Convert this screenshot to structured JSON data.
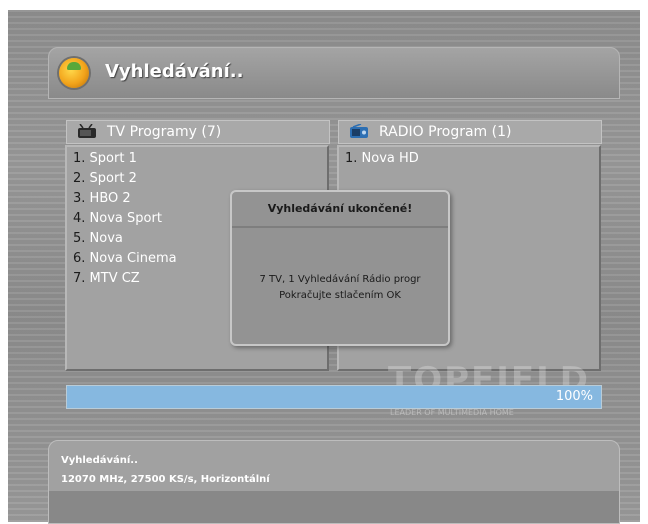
{
  "title": "Vyhledávání..",
  "tv_panel": {
    "title": "TV Programy (7)",
    "channels": [
      {
        "num": "1.",
        "name": "Sport 1"
      },
      {
        "num": "2.",
        "name": "Sport 2"
      },
      {
        "num": "3.",
        "name": "HBO 2"
      },
      {
        "num": "4.",
        "name": "Nova Sport"
      },
      {
        "num": "5.",
        "name": "Nova"
      },
      {
        "num": "6.",
        "name": "Nova Cinema"
      },
      {
        "num": "7.",
        "name": "MTV CZ"
      }
    ]
  },
  "radio_panel": {
    "title": "RADIO Program (1)",
    "channels": [
      {
        "num": "1.",
        "name": "Nova HD"
      }
    ]
  },
  "dialog": {
    "title": "Vyhledávání ukončené!",
    "line1": "7 TV, 1 Vyhledávání Rádio progr",
    "line2": "Pokračujte stlačením OK"
  },
  "progress": {
    "percent_label": "100%",
    "value": 100
  },
  "watermark": {
    "brand": "TOPFIELD",
    "tagline": "LEADER OF MULTIMEDIA HOME"
  },
  "info": {
    "status": "Vyhledávání..",
    "transponder": "12070 MHz, 27500 KS/s, Horizontální"
  },
  "colors": {
    "background": "#8f8f8f",
    "progress_fill": "#86b8e0",
    "text": "#ffffff"
  }
}
